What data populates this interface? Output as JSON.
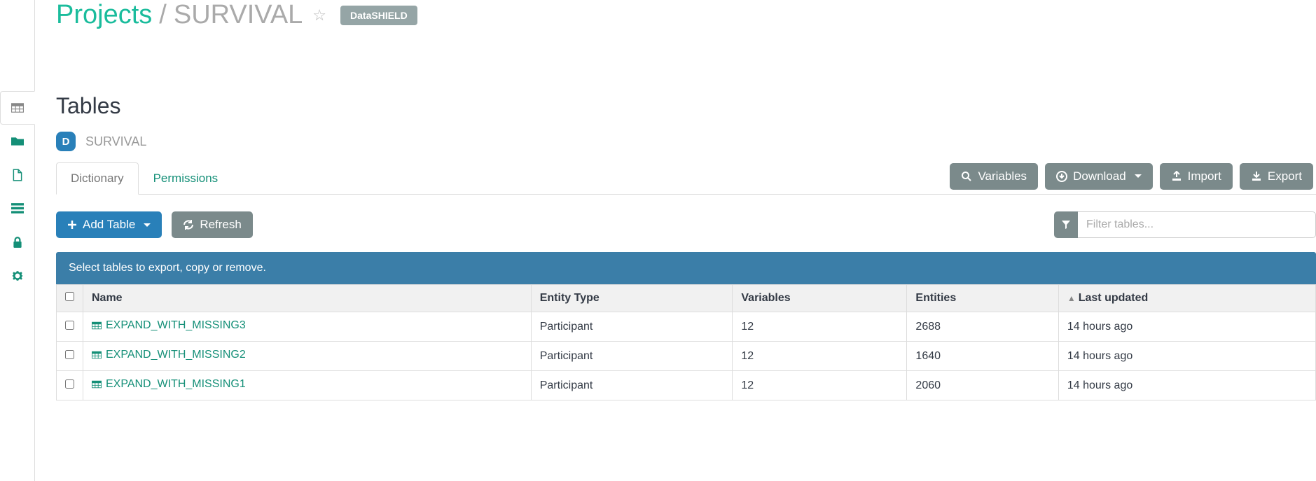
{
  "breadcrumb": {
    "root": "Projects",
    "sep": "/",
    "current": "SURVIVAL"
  },
  "tag": "DataSHIELD",
  "section_title": "Tables",
  "project": {
    "badge": "D",
    "name": "SURVIVAL"
  },
  "tabs": {
    "dictionary": "Dictionary",
    "permissions": "Permissions"
  },
  "actions": {
    "variables": "Variables",
    "download": "Download",
    "import": "Import",
    "export": "Export"
  },
  "toolbar": {
    "add_table": "Add Table",
    "refresh": "Refresh"
  },
  "filter": {
    "placeholder": "Filter tables..."
  },
  "info_text": "Select tables to export, copy or remove.",
  "columns": {
    "name": "Name",
    "entity_type": "Entity Type",
    "variables": "Variables",
    "entities": "Entities",
    "last_updated": "Last updated"
  },
  "rows": [
    {
      "name": "EXPAND_WITH_MISSING3",
      "entity_type": "Participant",
      "variables": "12",
      "entities": "2688",
      "last_updated": "14 hours ago"
    },
    {
      "name": "EXPAND_WITH_MISSING2",
      "entity_type": "Participant",
      "variables": "12",
      "entities": "1640",
      "last_updated": "14 hours ago"
    },
    {
      "name": "EXPAND_WITH_MISSING1",
      "entity_type": "Participant",
      "variables": "12",
      "entities": "2060",
      "last_updated": "14 hours ago"
    }
  ]
}
